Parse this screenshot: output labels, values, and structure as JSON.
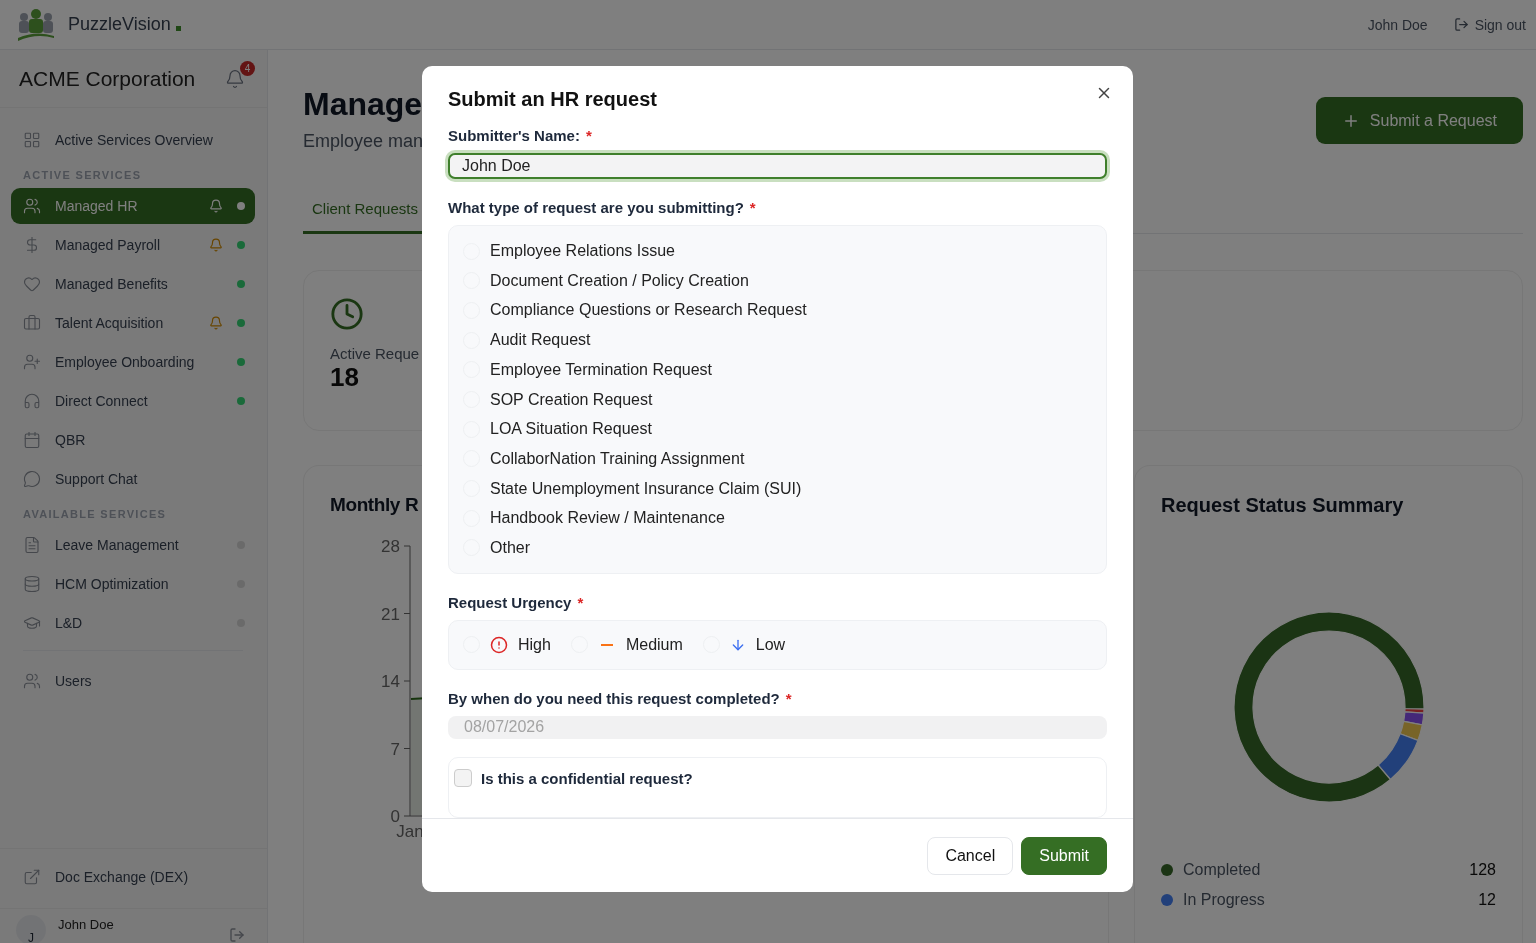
{
  "header": {
    "brand": "PuzzleVision",
    "user": "John Doe",
    "sign_out": "Sign out"
  },
  "sidebar": {
    "company": "ACME Corporation",
    "notifications": "4",
    "overview": {
      "label": "Active Services Overview",
      "selected": false
    },
    "sections": [
      {
        "title": "ACTIVE SERVICES",
        "items": [
          {
            "label": "Managed HR",
            "selected": true,
            "bell": true,
            "color": "#7f7f7f"
          },
          {
            "label": "Managed Payroll",
            "selected": false,
            "bell": true,
            "color": "#1a6a3a"
          },
          {
            "label": "Managed Benefits",
            "selected": false,
            "bell": false,
            "color": "#1a6a3a"
          },
          {
            "label": "Talent Acquisition",
            "selected": false,
            "bell": true,
            "color": "#1a6a3a"
          },
          {
            "label": "Employee Onboarding",
            "selected": false,
            "bell": false,
            "color": "#1a6a3a"
          },
          {
            "label": "Direct Connect",
            "selected": false,
            "bell": false,
            "color": "#1a6a3a"
          },
          {
            "label": "QBR",
            "selected": false,
            "bell": false
          },
          {
            "label": "Support Chat",
            "selected": false,
            "bell": false
          }
        ]
      },
      {
        "title": "AVAILABLE SERVICES",
        "items": [
          {
            "label": "Leave Management",
            "selected": false,
            "bell": false,
            "color": "#6a6a6a"
          },
          {
            "label": "HCM Optimization",
            "selected": false,
            "bell": false,
            "color": "#6a6a6a"
          },
          {
            "label": "L&D",
            "selected": false,
            "bell": false,
            "color": "#6a6a6a"
          }
        ]
      }
    ],
    "users": {
      "label": "Users",
      "selected": false
    },
    "doc_exchange": "Doc Exchange (DEX)",
    "account": {
      "initial": "J",
      "name": "John Doe"
    }
  },
  "main": {
    "title": "Manage",
    "subtitle": "Employee man",
    "submit_button": "Submit a Request",
    "tabs": [
      {
        "label": "Client Requests",
        "selected": true
      }
    ],
    "stat": {
      "label": "Active Reque",
      "value": "18"
    },
    "monthly_chart": {
      "title": "Monthly R",
      "y_axis_labels": [
        "28",
        "21",
        "14",
        "7",
        "0"
      ],
      "x_axis_labels": [
        "Jan"
      ]
    },
    "status_summary": {
      "title": "Request Status Summary",
      "chart_data": {
        "type": "donut",
        "values": [
          86.5,
          8.1,
          2.7,
          2,
          0.7
        ]
      },
      "legend": [
        {
          "label": "Completed",
          "count": "128",
          "color": "#1b3414"
        },
        {
          "label": "In Progress",
          "count": "12",
          "color": "#22407a"
        }
      ]
    }
  },
  "modal": {
    "title": "Submit an HR request",
    "name_field": {
      "label": "Submitter's Name:",
      "required_mark": "*",
      "value": "John Doe",
      "focused": true
    },
    "type_field": {
      "label": "What type of request are you submitting?",
      "required_mark": "*",
      "options": [
        {
          "label": "Employee Relations Issue",
          "selected": false
        },
        {
          "label": "Document Creation / Policy Creation",
          "selected": false
        },
        {
          "label": "Compliance Questions or Research Request",
          "selected": false
        },
        {
          "label": "Audit Request",
          "selected": false
        },
        {
          "label": "Employee Termination Request",
          "selected": false
        },
        {
          "label": "SOP Creation Request",
          "selected": false
        },
        {
          "label": "LOA Situation Request",
          "selected": false
        },
        {
          "label": "CollaborNation Training Assignment",
          "selected": false
        },
        {
          "label": "State Unemployment Insurance Claim (SUI)",
          "selected": false
        },
        {
          "label": "Handbook Review / Maintenance",
          "selected": false
        },
        {
          "label": "Other",
          "selected": false
        }
      ]
    },
    "urgency_field": {
      "label": "Request Urgency",
      "required_mark": "*",
      "options": [
        {
          "label": "High",
          "kind": "high",
          "selected": false
        },
        {
          "label": "Medium",
          "kind": "medium",
          "selected": false
        },
        {
          "label": "Low",
          "kind": "low",
          "selected": false
        }
      ]
    },
    "date_field": {
      "label": "By when do you need this request completed?",
      "required_mark": "*",
      "placeholder": "08/07/2026"
    },
    "confidential": {
      "label": "Is this a confidential request?",
      "checked": false
    },
    "buttons": {
      "cancel": "Cancel",
      "submit": "Submit"
    }
  }
}
